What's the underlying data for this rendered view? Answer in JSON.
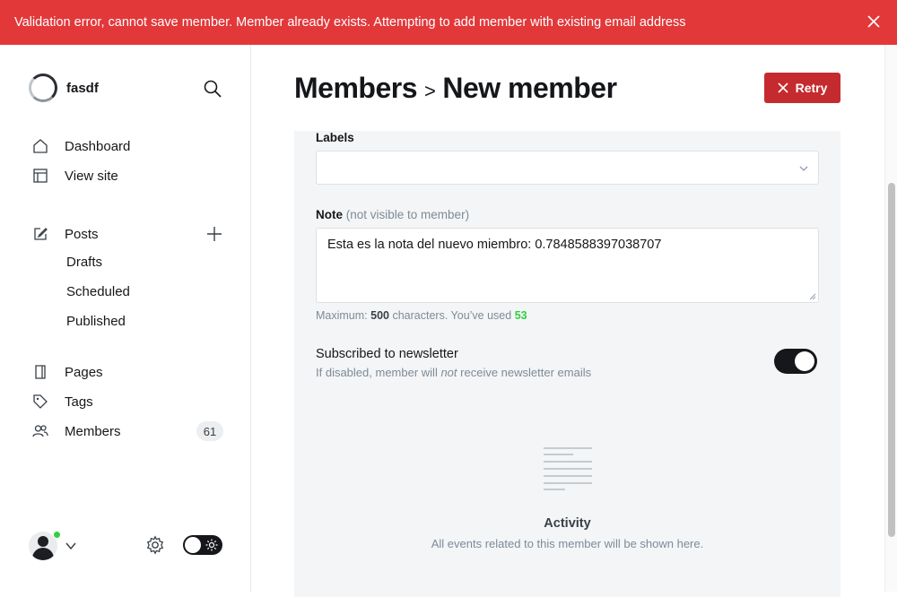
{
  "banner": {
    "message": "Validation error, cannot save member. Member already exists. Attempting to add member with existing email address",
    "color": "#e2383a"
  },
  "sidebar": {
    "site_name": "fasdf",
    "nav": [
      {
        "label": "Dashboard",
        "icon": "home-icon"
      },
      {
        "label": "View site",
        "icon": "layout-icon"
      }
    ],
    "posts": {
      "label": "Posts",
      "icon": "edit-icon",
      "sub": [
        "Drafts",
        "Scheduled",
        "Published"
      ]
    },
    "more": [
      {
        "label": "Pages",
        "icon": "page-icon"
      },
      {
        "label": "Tags",
        "icon": "tag-icon"
      },
      {
        "label": "Members",
        "icon": "members-icon",
        "badge": "61"
      }
    ]
  },
  "header": {
    "breadcrumb_parent": "Members",
    "breadcrumb_separator": ">",
    "title": "New member",
    "retry_label": "Retry",
    "retry_color": "#c52b2e"
  },
  "form": {
    "labels_label": "Labels",
    "note_label": "Note",
    "note_hint": "(not visible to member)",
    "note_value": "Esta es la nota del nuevo miembro: 0.7848588397038707",
    "counter_prefix": "Maximum:",
    "counter_max": "500",
    "counter_middle": "characters. You’ve used",
    "counter_used": "53",
    "newsletter_title": "Subscribed to newsletter",
    "newsletter_desc_1": "If disabled, member will",
    "newsletter_desc_em": "not",
    "newsletter_desc_2": "receive newsletter emails",
    "newsletter_enabled": true
  },
  "activity": {
    "title": "Activity",
    "description": "All events related to this member will be shown here."
  }
}
